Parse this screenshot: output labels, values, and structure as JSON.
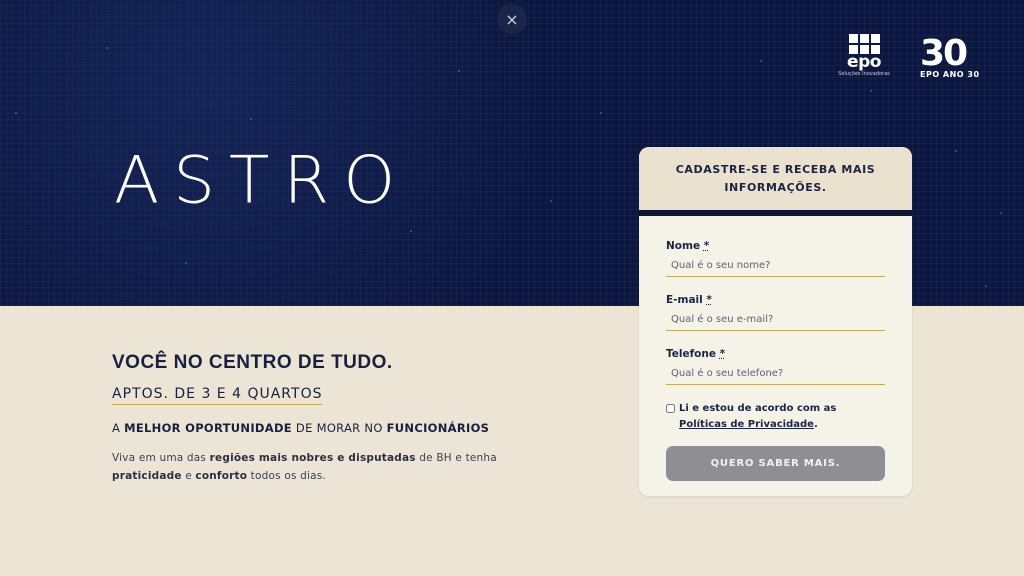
{
  "close": {
    "icon": "×"
  },
  "brand": {
    "epo_word": "epo",
    "epo_tagline": "Soluções Inovadoras",
    "anniversary_number": "30",
    "anniversary_text": "EPO  ANO 30",
    "project_name": "ASTRO"
  },
  "content": {
    "headline": "VOCÊ NO CENTRO DE TUDO.",
    "aptos": "APTOS. DE 3 E 4 QUARTOS",
    "opportunity": {
      "p1": "A ",
      "b1": "MELHOR OPORTUNIDADE",
      "p2": " DE MORAR NO ",
      "b2": "FUNCIONÁRIOS"
    },
    "description": {
      "p1": "Viva em uma das ",
      "b1": "regiões mais nobres e disputadas",
      "p2": " de BH e tenha ",
      "b2": "praticidade",
      "p3": " e ",
      "b3": "conforto",
      "p4": " todos os dias."
    }
  },
  "form": {
    "title": "CADASTRE-SE E RECEBA MAIS INFORMAÇÕES.",
    "fields": [
      {
        "label": "Nome",
        "required_mark": "*",
        "placeholder": "Qual é o seu nome?"
      },
      {
        "label": "E-mail",
        "required_mark": "*",
        "placeholder": "Qual é o seu e-mail?"
      },
      {
        "label": "Telefone",
        "required_mark": "*",
        "placeholder": "Qual é o seu telefone?"
      }
    ],
    "consent": {
      "text": "Li e estou de acordo com as ",
      "link": "Políticas de Privacidade",
      "suffix": "."
    },
    "submit_label": "QUERO SABER MAIS."
  },
  "colors": {
    "hero_bg": "#0b1740",
    "page_bg": "#ece5d6",
    "accent_gold": "#c9a85a",
    "button_gray": "#8d8f95"
  }
}
